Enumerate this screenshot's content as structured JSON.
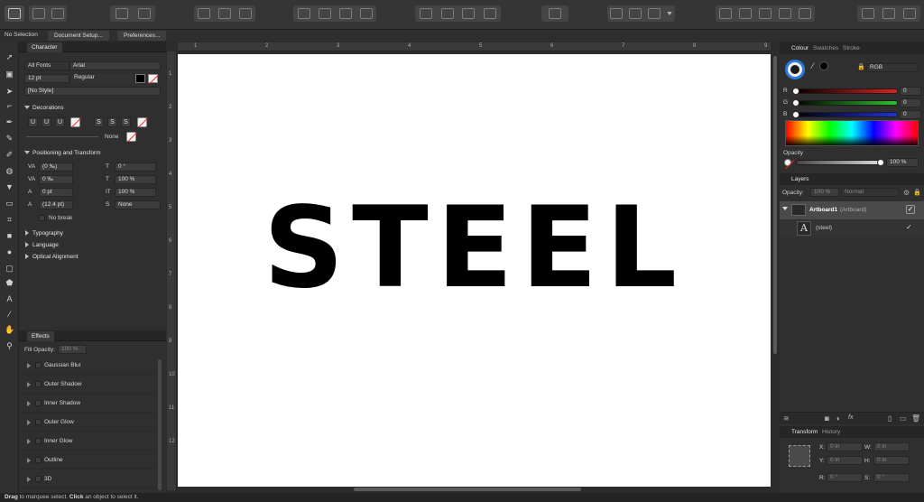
{
  "context_bar": {
    "selection": "No Selection",
    "document_setup": "Document Setup...",
    "preferences": "Preferences..."
  },
  "character": {
    "tab": "Character",
    "font_collection": "All Fonts",
    "font_family": "Arial",
    "font_size": "12 pt",
    "font_style": "Regular",
    "style": "[No Style]"
  },
  "decorations": {
    "title": "Decorations",
    "none_label": "None"
  },
  "positioning": {
    "title": "Positioning and Transform",
    "kerning": "(0 ‰)",
    "tracking": "0 ‰",
    "baseline": "0 pt",
    "leading": "(12.4 pt)",
    "skew": "0 °",
    "scale_h": "100 %",
    "scale_v": "100 %",
    "caps": "None",
    "no_break": "No break"
  },
  "sections": {
    "typography": "Typography",
    "language": "Language",
    "optical_alignment": "Optical Alignment"
  },
  "effects": {
    "tab": "Effects",
    "fill_opacity_label": "Fill Opacity:",
    "fill_opacity_value": "100 %",
    "items": [
      "Gaussian Blur",
      "Outer Shadow",
      "Inner Shadow",
      "Outer Glow",
      "Inner Glow",
      "Outline",
      "3D"
    ]
  },
  "canvas": {
    "text": "STEEL",
    "ruler_top": [
      "1",
      "2",
      "3",
      "4",
      "5",
      "6",
      "7",
      "8",
      "9"
    ],
    "ruler_left": [
      "1",
      "2",
      "3",
      "4",
      "5",
      "6",
      "7",
      "8",
      "9",
      "10",
      "11",
      "12"
    ]
  },
  "colour": {
    "tabs": [
      "Colour",
      "Swatches",
      "Stroke"
    ],
    "model": "RGB",
    "r_label": "R",
    "g_label": "G",
    "b_label": "B",
    "r": "0",
    "g": "0",
    "b": "0",
    "opacity_label": "Opacity",
    "opacity": "100 %",
    "accent_red": "#d42020",
    "accent_green": "#2fbf2f",
    "accent_blue": "#2030e0"
  },
  "layers": {
    "tab": "Layers",
    "opacity_label": "Opacity:",
    "opacity": "100 %",
    "blend": "Normal",
    "items": [
      {
        "name": "Artboard1",
        "kind": "(Artboard)"
      },
      {
        "name": "(steel)",
        "kind": ""
      }
    ]
  },
  "transform": {
    "tabs": [
      "Transform",
      "History"
    ],
    "x_label": "X:",
    "y_label": "Y:",
    "w_label": "W:",
    "h_label": "H:",
    "r_label": "R:",
    "s_label": "S:",
    "x": "0 in",
    "y": "0 in",
    "w": "0 in",
    "h": "0 in",
    "r": "0 °",
    "s": "0 °"
  },
  "status": {
    "drag": "Drag",
    "drag_rest": " to marquee select. ",
    "click": "Click",
    "click_rest": " an object to select it."
  }
}
